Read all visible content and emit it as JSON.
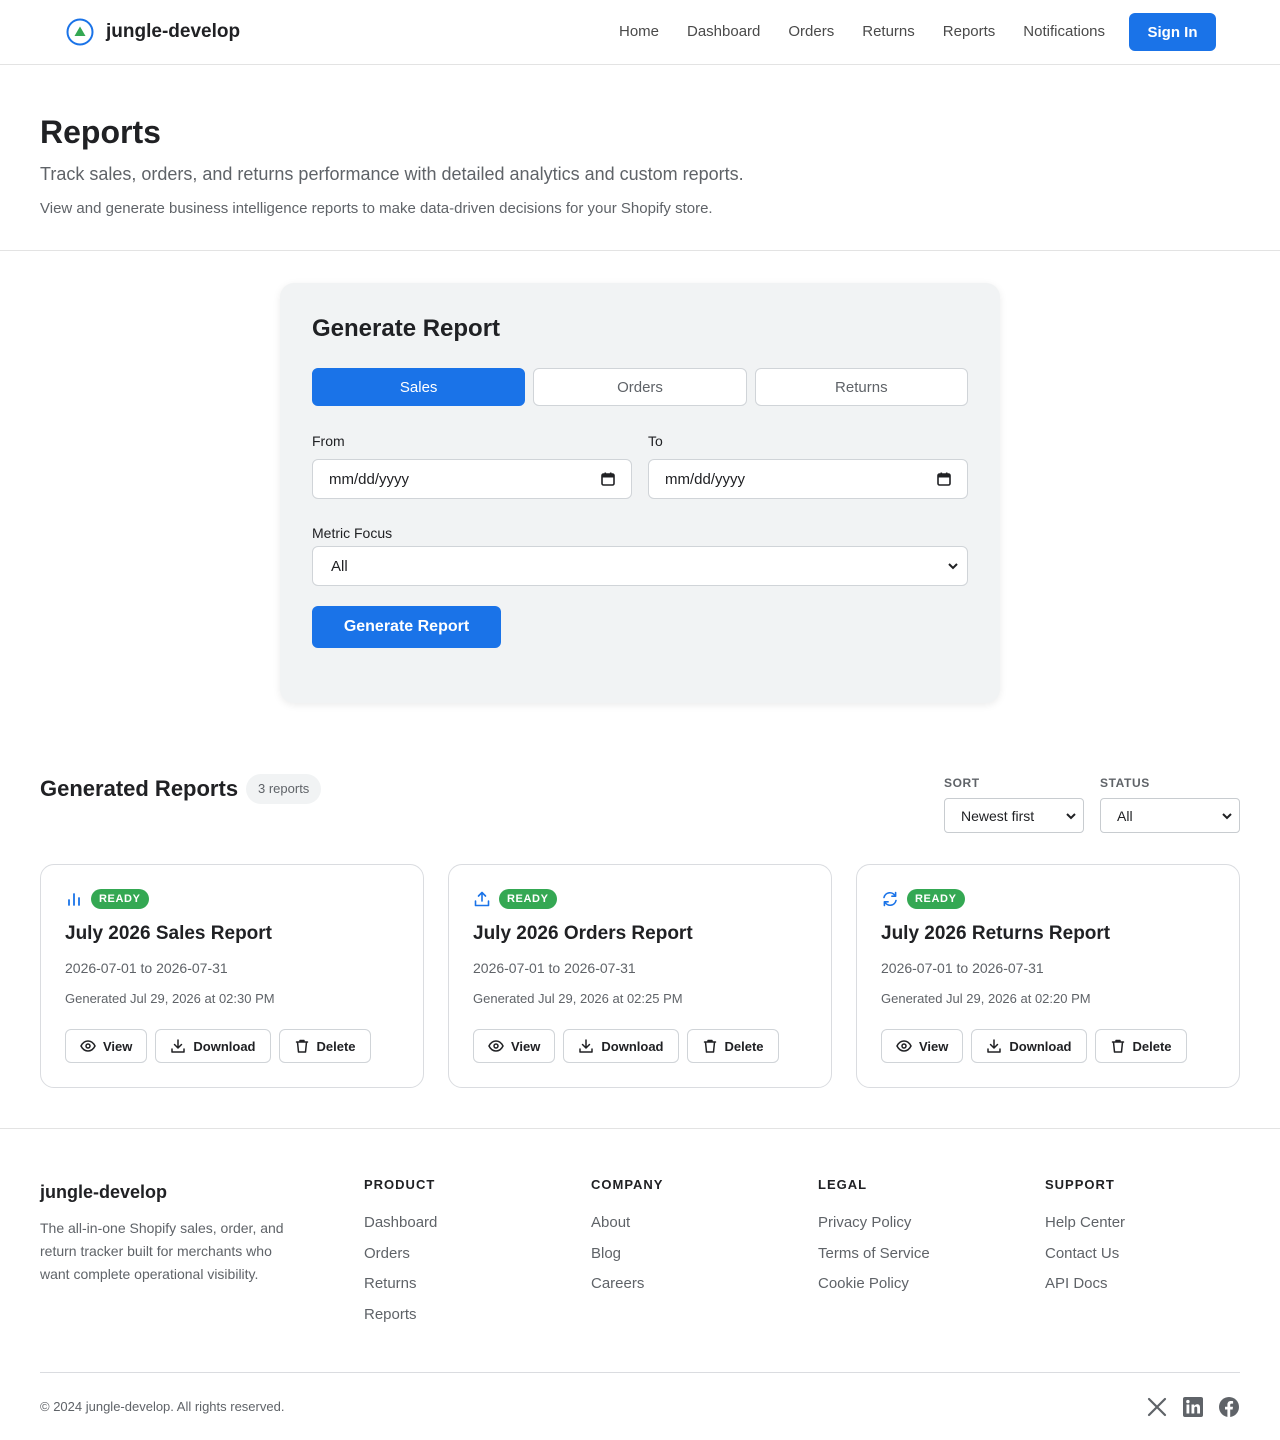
{
  "header": {
    "brand": "jungle-develop",
    "nav": [
      "Home",
      "Dashboard",
      "Orders",
      "Returns",
      "Reports",
      "Notifications"
    ],
    "signin_label": "Sign In",
    "colors": {
      "primary": "#1a73e8",
      "logo_accent": "#34a853"
    }
  },
  "hero": {
    "title": "Reports",
    "subtitle": "Track sales, orders, and returns performance with detailed analytics and custom reports.",
    "description": "View and generate business intelligence reports to make data-driven decisions for your Shopify store."
  },
  "generator": {
    "title": "Generate Report",
    "tabs": [
      "Sales",
      "Orders",
      "Returns"
    ],
    "active_tab": "Sales",
    "from_label": "From",
    "from_value": "mm/dd/yyyy",
    "to_label": "To",
    "to_value": "mm/dd/yyyy",
    "metric_label": "Metric Focus",
    "metric_value": "All",
    "submit_label": "Generate Report"
  },
  "reports": {
    "title": "Generated Reports",
    "count_label": "3 reports",
    "sort_label": "SORT",
    "sort_value": "Newest first",
    "status_label": "STATUS",
    "status_value": "All",
    "items": [
      {
        "icon": "bar-chart-icon",
        "status": "READY",
        "title": "July 2026 Sales Report",
        "range": "2026-07-01 to 2026-07-31",
        "generated": "Generated Jul 29, 2026 at 02:30 PM"
      },
      {
        "icon": "upload-icon",
        "status": "READY",
        "title": "July 2026 Orders Report",
        "range": "2026-07-01 to 2026-07-31",
        "generated": "Generated Jul 29, 2026 at 02:25 PM"
      },
      {
        "icon": "refresh-icon",
        "status": "READY",
        "title": "July 2026 Returns Report",
        "range": "2026-07-01 to 2026-07-31",
        "generated": "Generated Jul 29, 2026 at 02:20 PM"
      }
    ],
    "actions": {
      "view": "View",
      "download": "Download",
      "delete": "Delete"
    },
    "status_color": "#34a853"
  },
  "footer": {
    "brand": "jungle-develop",
    "tagline": "The all-in-one Shopify sales, order, and return tracker built for merchants who want complete operational visibility.",
    "columns": [
      {
        "heading": "PRODUCT",
        "links": [
          "Dashboard",
          "Orders",
          "Returns",
          "Reports"
        ]
      },
      {
        "heading": "COMPANY",
        "links": [
          "About",
          "Blog",
          "Careers"
        ]
      },
      {
        "heading": "LEGAL",
        "links": [
          "Privacy Policy",
          "Terms of Service",
          "Cookie Policy"
        ]
      },
      {
        "heading": "SUPPORT",
        "links": [
          "Help Center",
          "Contact Us",
          "API Docs"
        ]
      }
    ],
    "copyright": "© 2024 jungle-develop. All rights reserved.",
    "social": [
      "x-icon",
      "linkedin-icon",
      "facebook-icon"
    ]
  }
}
